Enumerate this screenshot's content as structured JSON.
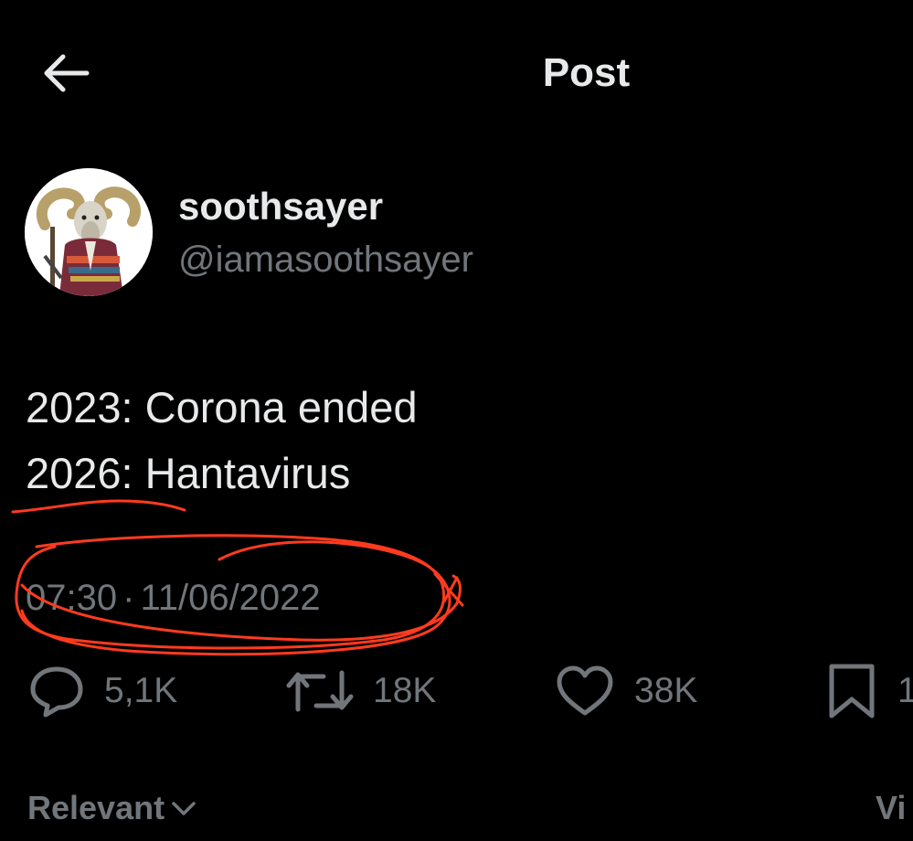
{
  "header": {
    "title": "Post",
    "back_icon": "arrow-left-icon"
  },
  "author": {
    "display_name": "soothsayer",
    "handle": "@iamasoothsayer"
  },
  "tweet": {
    "lines": [
      "2023: Corona ended",
      "2026: Hantavirus"
    ],
    "time": "07:30",
    "separator": "·",
    "date": "11/06/2022"
  },
  "actions": {
    "reply_count": "5,1K",
    "repost_count": "18K",
    "like_count": "38K",
    "bookmark_count": "1"
  },
  "sort": {
    "label": "Relevant",
    "view_label": "Vi"
  },
  "colors": {
    "background": "#000000",
    "primary_text": "#e7e9ea",
    "secondary_text": "#71767b",
    "annotation_red": "#ff3b1f"
  }
}
